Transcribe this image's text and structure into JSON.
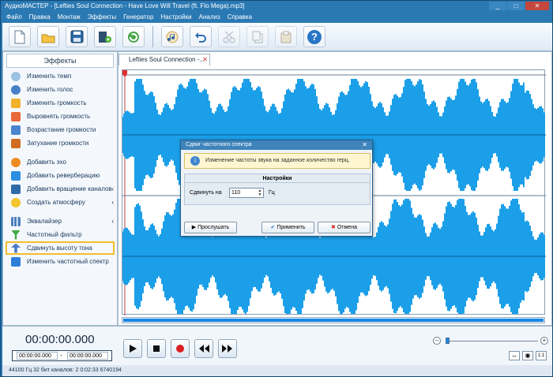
{
  "window": {
    "title": "АудиоМАСТЕР - [Lefties Soul Connection - Have Love Will Travel (ft. Flo Mega).mp3]",
    "controls": [
      "_",
      "□",
      "✕"
    ]
  },
  "menu": [
    "Файл",
    "Правка",
    "Монтаж",
    "Эффекты",
    "Генератор",
    "Настройки",
    "Анализ",
    "Справка"
  ],
  "toolbar": {
    "icons": [
      "new-file-icon",
      "open-folder-icon",
      "save-icon",
      "export-icon",
      "refresh-icon",
      "audio-icon",
      "undo-icon",
      "cut-icon",
      "copy-icon",
      "paste-icon",
      "help-icon"
    ],
    "help": "?"
  },
  "left_panel": {
    "title": "Эффекты",
    "items": [
      "Изменить темп",
      "Изменить голос",
      "Изменить громкость",
      "Выровнять громкость",
      "Возрастание громкости",
      "Затухание громкости",
      "Добавить эхо",
      "Добавить реверберацию",
      "Добавить вращение каналов",
      "Создать атмосферу",
      "Эквалайзер",
      "Частотный фильтр",
      "Сдвинуть высоту тона",
      "Изменить частотный спектр"
    ]
  },
  "editor": {
    "tab": "Lefties Soul Connection -...",
    "tab_close": "✕"
  },
  "transport": {
    "time": "00:00:00.000",
    "range_start": "00:00:00.000",
    "range_dash": "-",
    "range_end": "00:00:00.000"
  },
  "zoom": {
    "minus": "−",
    "plus": "+",
    "level": 0.04,
    "ratio": "1:1"
  },
  "status": {
    "text": "44100 Гц  32 бит  каналов: 2   0:02:33  6740194"
  },
  "dialog": {
    "title": "Сдвиг частотного спектра",
    "close": "✕",
    "info": "Изменение частоты звука на заданное количество герц.",
    "settings_title": "Настройки",
    "shift_label": "Сдвинуть на",
    "shift_value": "110",
    "unit": "Гц",
    "listen": "Прослушать",
    "apply": "Применить",
    "cancel": "Отмена"
  },
  "colors": {
    "waveform": "#1b9fe8",
    "titlebar": "#2a79b3",
    "highlight": "#f5bd2e"
  }
}
